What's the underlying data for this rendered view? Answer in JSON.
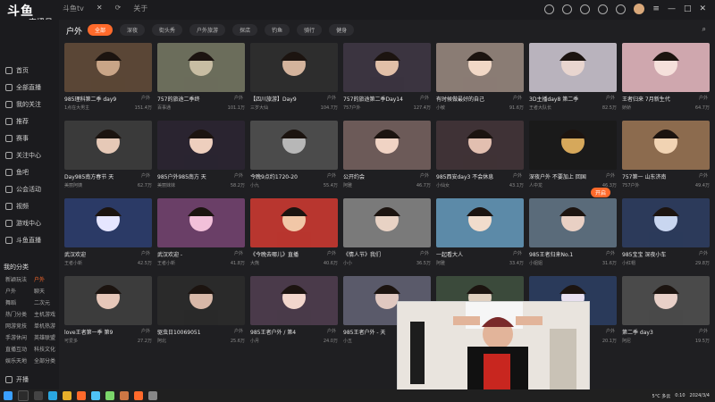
{
  "app": {
    "brand": "斗鱼",
    "subtitle": "直播号",
    "room_id": "241123"
  },
  "window_tabs": [
    "斗鱼tv",
    "关于"
  ],
  "sidebar": {
    "items": [
      "首页",
      "全部直播",
      "我的关注",
      "推荐",
      "赛事",
      "关注中心",
      "鱼吧",
      "公会活动",
      "视频",
      "游戏中心",
      "斗鱼直播"
    ],
    "section_title": "我的分类",
    "categories": [
      "新颖玩法",
      "户外",
      "户外",
      "聊天",
      "舞蹈",
      "二次元",
      "热门分类",
      "主机游戏",
      "网游竞技",
      "单机热游",
      "手游休闲",
      "英雄联盟",
      "直播互动",
      "科技文化",
      "娱乐天地",
      "全部分类"
    ],
    "active_category": "户外",
    "footer": "开播"
  },
  "main": {
    "section_title": "户外",
    "filters": [
      "全部",
      "深夜",
      "街头秀",
      "户外旅游",
      "探店",
      "钓鱼",
      "骑行",
      "健身"
    ],
    "active_filter": "全部"
  },
  "cards": [
    {
      "title": "985理科第二季 day9",
      "streamer": "1点在大男主",
      "viewers": "151.4万",
      "category": "户外"
    },
    {
      "title": "757的旅途二季终",
      "streamer": "百事通",
      "viewers": "101.1万",
      "category": "户外"
    },
    {
      "title": "【四川旅游】Day9",
      "streamer": "三岁大仙",
      "viewers": "104.7万",
      "category": "户外"
    },
    {
      "title": "757的旅途第二季Day14",
      "streamer": "757户外",
      "viewers": "127.4万",
      "category": "户外"
    },
    {
      "title": "有时候做最好的自己",
      "streamer": "小敏",
      "viewers": "91.6万",
      "category": "户外"
    },
    {
      "title": "3D主播day8 第二季",
      "streamer": "王者大队长",
      "viewers": "82.5万",
      "category": "户外"
    },
    {
      "title": "王者归来 7月新生代",
      "streamer": "娇娇",
      "viewers": "64.7万",
      "category": "户外"
    },
    {
      "title": "Day985南方春节 天",
      "streamer": "美丽阿姨",
      "viewers": "62.7万",
      "category": "户外"
    },
    {
      "title": "985户外985南方 天",
      "streamer": "美丽妹妹",
      "viewers": "58.2万",
      "category": "户外"
    },
    {
      "title": "今晚9点约1720-20",
      "streamer": "小九",
      "viewers": "55.4万",
      "category": "户外"
    },
    {
      "title": "公开约会",
      "streamer": "阿雅",
      "viewers": "46.7万",
      "category": "户外"
    },
    {
      "title": "985西安day3 不会休息",
      "streamer": "小仙女",
      "viewers": "43.1万",
      "category": "户外"
    },
    {
      "title": "深夜户外 不要加上 回国",
      "streamer": "人中龙",
      "viewers": "46.3万",
      "category": "户外"
    },
    {
      "title": "757第一 山东济南",
      "streamer": "757户外",
      "viewers": "49.4万",
      "category": "户外"
    },
    {
      "title": "武汉欢迎",
      "streamer": "王者小新",
      "viewers": "42.5万",
      "category": "户外"
    },
    {
      "title": "武汉欢迎 -",
      "streamer": "王者小新",
      "viewers": "41.8万",
      "category": "户外"
    },
    {
      "title": "《今晚去哪儿》直播",
      "streamer": "大熊",
      "viewers": "40.6万",
      "category": "户外"
    },
    {
      "title": "《情人节》我们",
      "streamer": "小小",
      "viewers": "36.5万",
      "category": "户外"
    },
    {
      "title": "一起看大人",
      "streamer": "阿雅",
      "viewers": "33.4万",
      "category": "户外"
    },
    {
      "title": "985王者归来No.1",
      "streamer": "小姐姐",
      "viewers": "31.6万",
      "category": "户外"
    },
    {
      "title": "985宝宝 深夜小车",
      "streamer": "小红帽",
      "viewers": "29.8万",
      "category": "户外"
    },
    {
      "title": "love王者第一季 第9",
      "streamer": "可爱多",
      "viewers": "27.2万",
      "category": "户外"
    },
    {
      "title": "驱虫日10069051",
      "streamer": "阿北",
      "viewers": "25.6万",
      "category": "户外"
    },
    {
      "title": "985王者户外 / 第4",
      "streamer": "小月",
      "viewers": "24.0万",
      "category": "户外"
    },
    {
      "title": "985王者户外 - 天",
      "streamer": "小五",
      "viewers": "22.7万",
      "category": "户外"
    },
    {
      "title": "小红帽 day9",
      "streamer": "小红帽",
      "viewers": "21.4万",
      "category": "户外"
    },
    {
      "title": "王者风采",
      "streamer": "美丽",
      "viewers": "20.1万",
      "category": "户外"
    },
    {
      "title": "第二季 day3",
      "streamer": "阿尼",
      "viewers": "19.5万",
      "category": "户外"
    }
  ],
  "overlay": {
    "sound_button": "开启"
  },
  "taskbar": {
    "weather": "5°C 多云",
    "time": "0:10",
    "date": "2024/3/4"
  }
}
